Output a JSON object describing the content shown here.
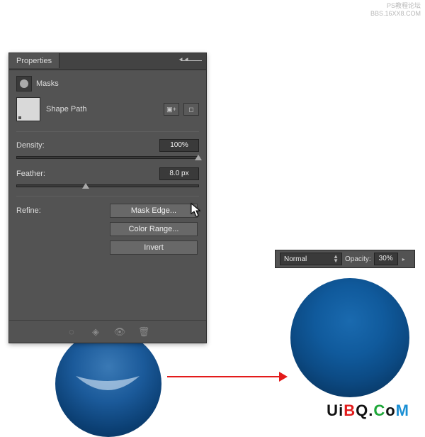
{
  "watermark": {
    "line1": "PS教程论坛",
    "line2": "BBS.16XX8.COM"
  },
  "panel": {
    "tab_label": "Properties",
    "masks_label": "Masks",
    "shape_label": "Shape Path",
    "density": {
      "label": "Density:",
      "value": "100%",
      "thumb_percent": 100
    },
    "feather": {
      "label": "Feather:",
      "value": "8.0 px",
      "thumb_percent": 38
    },
    "refine_label": "Refine:",
    "buttons": {
      "mask_edge": "Mask Edge...",
      "color_range": "Color Range...",
      "invert": "Invert"
    }
  },
  "opacity_panel": {
    "blend_mode": "Normal",
    "opacity_label": "Opacity:",
    "opacity_value": "30%"
  },
  "brand": {
    "u": "U",
    "i": "i",
    "b": "B",
    "q": "Q",
    "dot": ".",
    "c": "C",
    "o": "o",
    "m": "M"
  }
}
